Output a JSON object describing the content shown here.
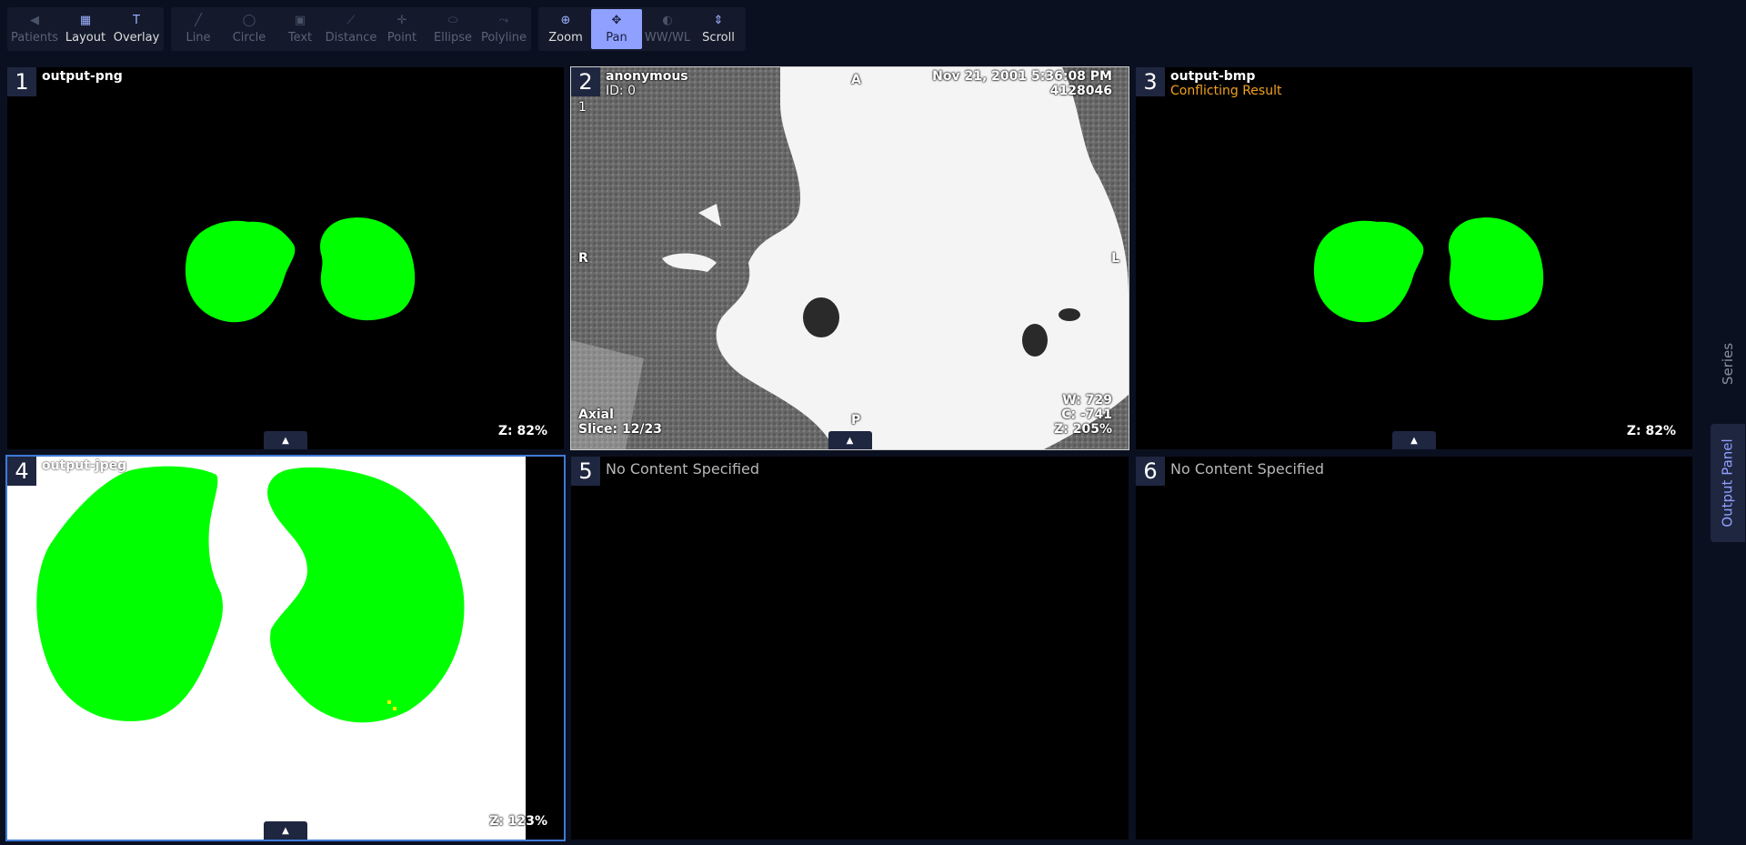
{
  "toolbar": {
    "groups": [
      [
        {
          "label": "Patients",
          "icon": "chevron-left-icon",
          "state": "disabled"
        },
        {
          "label": "Layout",
          "icon": "layout-grid-icon",
          "state": "normal"
        },
        {
          "label": "Overlay",
          "icon": "text-overlay-icon",
          "state": "normal"
        }
      ],
      [
        {
          "label": "Line",
          "icon": "line-icon",
          "state": "disabled"
        },
        {
          "label": "Circle",
          "icon": "circle-icon",
          "state": "disabled"
        },
        {
          "label": "Text",
          "icon": "text-box-icon",
          "state": "disabled"
        },
        {
          "label": "Distance",
          "icon": "ruler-icon",
          "state": "disabled"
        },
        {
          "label": "Point",
          "icon": "crosshair-icon",
          "state": "disabled"
        },
        {
          "label": "Ellipse",
          "icon": "ellipse-icon",
          "state": "disabled"
        },
        {
          "label": "Polyline",
          "icon": "polyline-icon",
          "state": "disabled"
        }
      ],
      [
        {
          "label": "Zoom",
          "icon": "zoom-icon",
          "state": "normal"
        },
        {
          "label": "Pan",
          "icon": "pan-icon",
          "state": "active"
        },
        {
          "label": "WW/WL",
          "icon": "contrast-icon",
          "state": "disabled"
        },
        {
          "label": "Scroll",
          "icon": "scroll-icon",
          "state": "normal"
        }
      ]
    ]
  },
  "panes": {
    "p1": {
      "number": "1",
      "title": "output-png",
      "zoom": "Z: 82%"
    },
    "p2": {
      "number": "2",
      "patient_name": "anonymous",
      "patient_id": "ID: 0",
      "series": "1",
      "date": "Nov 21, 2001 5:36:08 PM",
      "accession": "4128046",
      "orient_top": "A",
      "orient_left": "R",
      "orient_right": "L",
      "orient_bottom": "P",
      "plane": "Axial",
      "slice": "Slice: 12/23",
      "window_width": "W: 729",
      "window_center": "C: -741",
      "zoom": "Z: 205%"
    },
    "p3": {
      "number": "3",
      "title": "output-bmp",
      "subtitle": "Conflicting Result",
      "zoom": "Z: 82%"
    },
    "p4": {
      "number": "4",
      "title": "output-jpeg",
      "zoom": "Z: 123%"
    },
    "p5": {
      "number": "5",
      "message": "No Content Specified"
    },
    "p6": {
      "number": "6",
      "message": "No Content Specified"
    }
  },
  "side_tabs": {
    "series": "Series",
    "output": "Output Panel"
  },
  "colors": {
    "mask": "#00ff00",
    "accent": "#8fa0ff",
    "warning": "#f0a020",
    "selected_border": "#3d7bd8"
  }
}
